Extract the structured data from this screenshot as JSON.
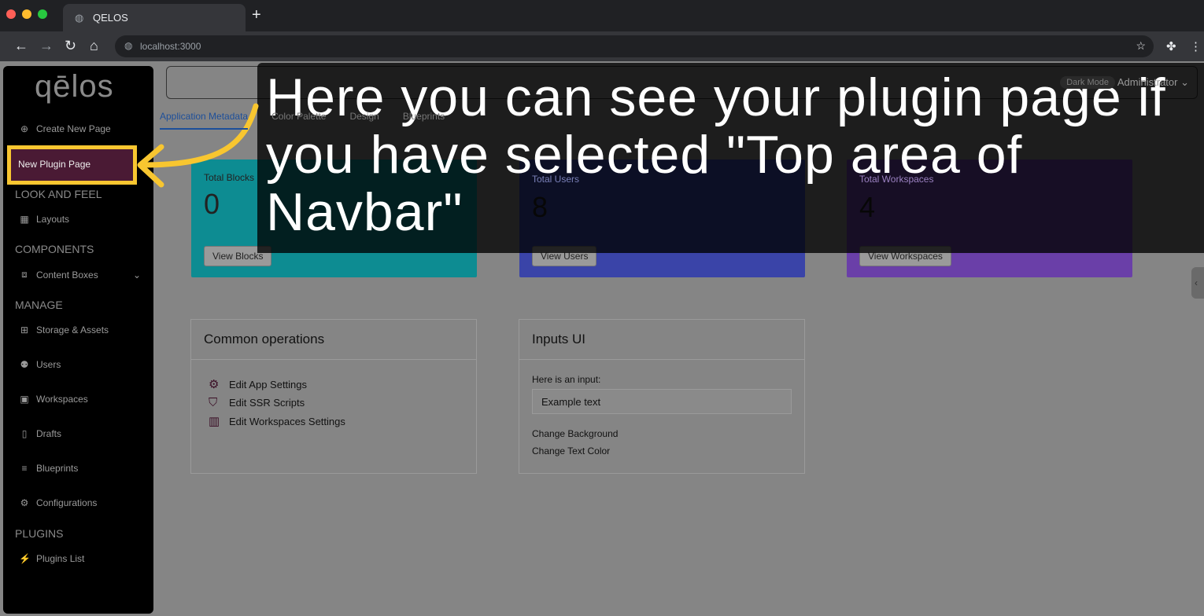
{
  "browser": {
    "tab_title": "QELOS",
    "url": "localhost:3000"
  },
  "sidebar": {
    "logo": "qēlos",
    "create": "Create New Page",
    "active": "New Plugin Page",
    "sections": [
      {
        "title": "LOOK AND FEEL"
      },
      {
        "title": "COMPONENTS"
      },
      {
        "title": "MANAGE"
      },
      {
        "title": "PLUGINS"
      }
    ],
    "items": {
      "layouts": "Layouts",
      "content_boxes": "Content Boxes",
      "storage": "Storage & Assets",
      "users": "Users",
      "workspaces": "Workspaces",
      "drafts": "Drafts",
      "blueprints": "Blueprints",
      "configurations": "Configurations",
      "plugins_list": "Plugins List"
    }
  },
  "header": {
    "dark_mode": "Dark Mode",
    "user": "Administrator"
  },
  "tabs": [
    "Application Metadata",
    "Color Palette",
    "Design",
    "Blueprints"
  ],
  "stats": [
    {
      "label": "Total Blocks",
      "value": "0",
      "button": "View Blocks",
      "color": "#0d9aa0"
    },
    {
      "label": "Total Users",
      "value": "8",
      "button": "View Users",
      "color": "#3a44a8"
    },
    {
      "label": "Total Workspaces",
      "value": "4",
      "button": "View Workspaces",
      "color": "#6a3fa8"
    }
  ],
  "common": {
    "title": "Common operations",
    "ops": [
      "Edit App Settings",
      "Edit SSR Scripts",
      "Edit Workspaces Settings"
    ]
  },
  "inputs": {
    "title": "Inputs UI",
    "label": "Here is an input:",
    "value": "Example text",
    "link1": "Change Background",
    "link2": "Change Text Color"
  },
  "caption": "Here you can see your plugin page if you have selected \"Top area of Navbar\"",
  "highlight_color": "#f8c630"
}
